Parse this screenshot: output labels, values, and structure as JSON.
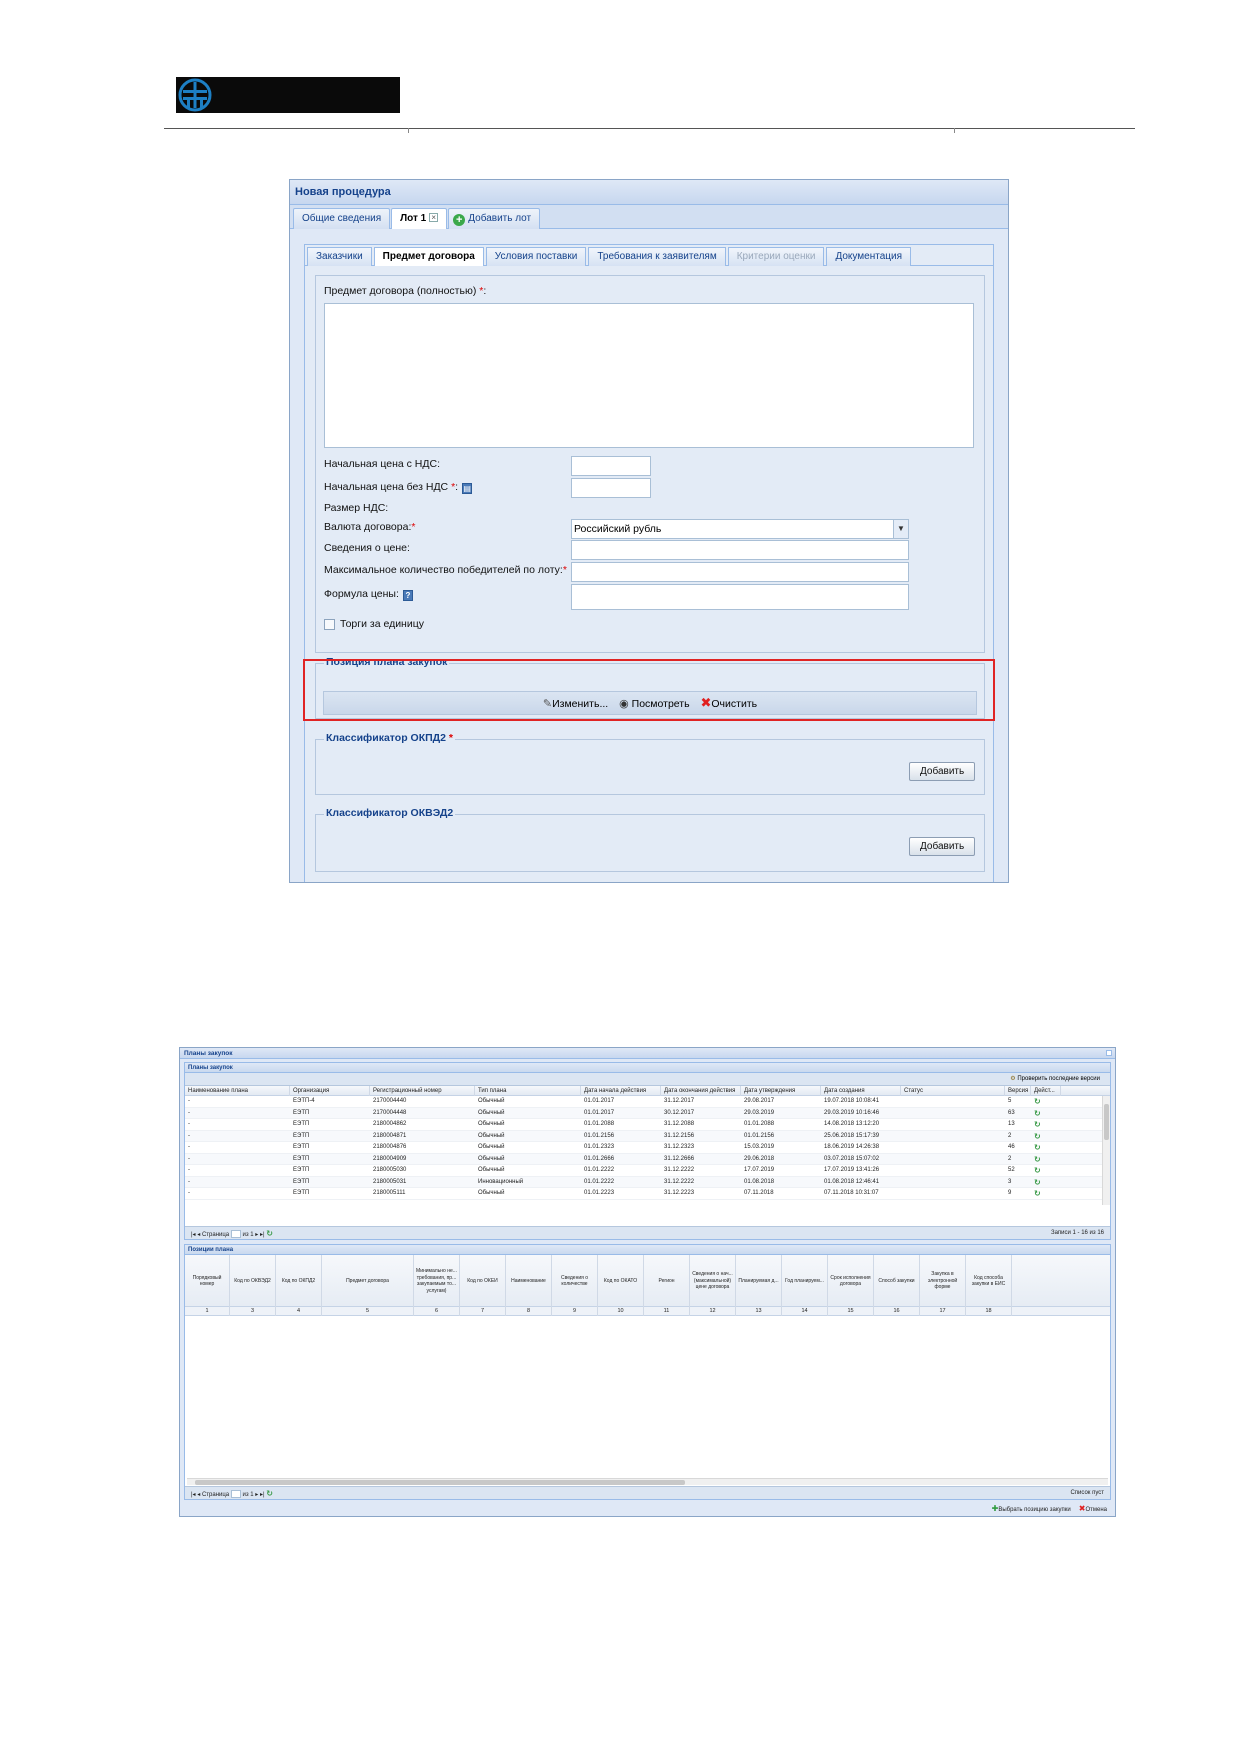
{
  "form": {
    "title": "Новая процедура",
    "tabs": {
      "general": "Общие сведения",
      "lot": "Лот 1",
      "lot_close": "×",
      "add_lot": "Добавить лот",
      "add_lot_icon": "add-circle-icon"
    },
    "subtabs": [
      "Заказчики",
      "Предмет договора",
      "Условия поставки",
      "Требования к заявителям",
      "Критерии оценки",
      "Документация"
    ],
    "fields": {
      "subject_label": "Предмет договора (полностью)",
      "req_mark": "*",
      "colon": ":",
      "price_with_vat": "Начальная цена с НДС:",
      "price_without_vat": "Начальная цена без НДС",
      "vat_size": "Размер НДС:",
      "currency_label": "Валюта договора:",
      "currency_value": "Российский рубль",
      "price_info": "Сведения о цене:",
      "max_winners": "Максимальное количество победителей по лоту:",
      "price_formula": "Формула цены:",
      "unit_bidding": "Торги за единицу"
    },
    "plan_position": {
      "legend": "Позиция плана закупок",
      "edit": "Изменить...",
      "view": "Посмотреть",
      "clear": "Очистить"
    },
    "okpd2": {
      "legend": "Классификатор ОКПД2",
      "req_mark": "*",
      "add": "Добавить"
    },
    "okved2": {
      "legend": "Классификатор ОКВЭД2",
      "add": "Добавить"
    },
    "highlight_color": "#e02424"
  },
  "plans_dialog": {
    "title": "Планы закупок",
    "plans_panel_title": "Планы закупок",
    "check_versions": "Проверить последние версии",
    "columns": [
      "Наименование плана",
      "Организация",
      "Регистрационный номер",
      "Тип плана",
      "Дата начала действия",
      "Дата окончания действия",
      "Дата утверждения",
      "Дата создания",
      "Статус",
      "Версия",
      "Дейст..."
    ],
    "rows": [
      [
        "-",
        "ЕЭТП-4",
        "2170004440",
        "Обычный",
        "01.01.2017",
        "31.12.2017",
        "29.08.2017",
        "19.07.2018 10:08:41",
        "",
        "5"
      ],
      [
        "-",
        "ЕЭТП",
        "2170004448",
        "Обычный",
        "01.01.2017",
        "30.12.2017",
        "29.03.2019",
        "29.03.2019 10:16:46",
        "",
        "63"
      ],
      [
        "-",
        "ЕЭТП",
        "2180004862",
        "Обычный",
        "01.01.2088",
        "31.12.2088",
        "01.01.2088",
        "14.08.2018 13:12:20",
        "",
        "13"
      ],
      [
        "-",
        "ЕЭТП",
        "2180004871",
        "Обычный",
        "01.01.2156",
        "31.12.2156",
        "01.01.2156",
        "25.06.2018 15:17:39",
        "",
        "2"
      ],
      [
        "-",
        "ЕЭТП",
        "2180004876",
        "Обычный",
        "01.01.2323",
        "31.12.2323",
        "15.03.2019",
        "18.06.2019 14:26:38",
        "",
        "46"
      ],
      [
        "-",
        "ЕЭТП",
        "2180004909",
        "Обычный",
        "01.01.2666",
        "31.12.2666",
        "29.06.2018",
        "03.07.2018 15:07:02",
        "",
        "2"
      ],
      [
        "-",
        "ЕЭТП",
        "2180005030",
        "Обычный",
        "01.01.2222",
        "31.12.2222",
        "17.07.2019",
        "17.07.2019 13:41:26",
        "",
        "52"
      ],
      [
        "-",
        "ЕЭТП",
        "2180005031",
        "Инновационный",
        "01.01.2222",
        "31.12.2222",
        "01.08.2018",
        "01.08.2018 12:46:41",
        "",
        "3"
      ],
      [
        "-",
        "ЕЭТП",
        "2180005111",
        "Обычный",
        "01.01.2223",
        "31.12.2223",
        "07.11.2018",
        "07.11.2018 10:31:07",
        "",
        "9"
      ]
    ],
    "action_icon": "refresh-icon",
    "pager": {
      "page": "Страница",
      "of": "из 1",
      "records": "Записи 1 - 16 из 16",
      "empty": "Список пуст"
    },
    "positions_panel_title": "Позиции плана",
    "position_columns": [
      "Порядковый номер",
      "Код по ОКВЭД2",
      "Код по ОКПД2",
      "Предмет договора",
      "Минимально не... требования, пр... закупаемым то... услугам)",
      "Код по ОКЕИ",
      "Наименование",
      "Сведения о количестве",
      "Код по ОКАТО",
      "Регион",
      "Сведения о нач... (максимальной) цене договора",
      "Планируемая д...",
      "Год планируем...",
      "Срок исполнения договора",
      "Способ закупки",
      "Закупка в электронной форме",
      "Код способа закупки в ЕИС"
    ],
    "position_numbers": [
      "1",
      "3",
      "4",
      "5",
      "6",
      "7",
      "8",
      "9",
      "10",
      "11",
      "12",
      "13",
      "14",
      "15",
      "16",
      "17",
      "18"
    ],
    "select_position": "Выбрать позицию закупки",
    "cancel": "Отмена"
  }
}
